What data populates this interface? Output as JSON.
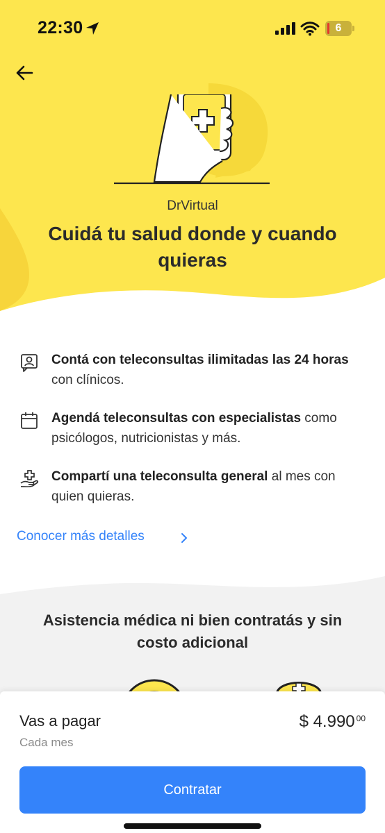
{
  "status_bar": {
    "time": "22:30",
    "battery_level": "6"
  },
  "hero": {
    "subtitle": "DrVirtual",
    "title": "Cuidá tu salud donde y cuando quieras"
  },
  "features": [
    {
      "icon": "user-chat-icon",
      "bold": "Contá con teleconsultas ilimitadas las 24 horas",
      "text": " con clínicos."
    },
    {
      "icon": "calendar-icon",
      "bold": "Agendá teleconsultas con especialistas",
      "text": " como psicólogos, nutricionistas y más."
    },
    {
      "icon": "hand-health-icon",
      "bold": "Compartí una teleconsulta general",
      "text": " al mes con quien quieras."
    }
  ],
  "details_link": "Conocer más detalles",
  "assistance": {
    "title": "Asistencia médica ni bien contratás y sin costo adicional"
  },
  "payment": {
    "label": "Vas a pagar",
    "period": "Cada mes",
    "price_main": "$ 4.990",
    "price_cents": "00",
    "cta": "Contratar"
  },
  "colors": {
    "hero_yellow": "#fde64e",
    "accent_blue": "#3483fa"
  }
}
